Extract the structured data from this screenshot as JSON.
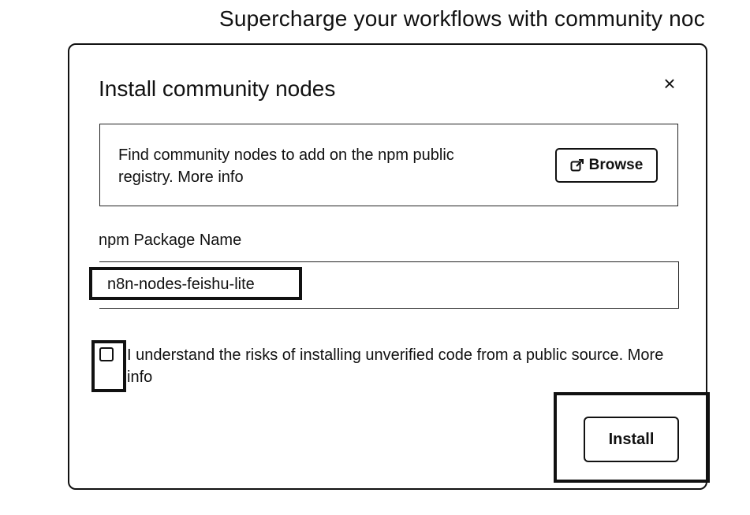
{
  "background": {
    "heading": "Supercharge your workflows with community noc"
  },
  "dialog": {
    "title": "Install community nodes",
    "close_icon": "×",
    "info": {
      "text": "Find community nodes to add on the npm public registry. More info",
      "browse_label": "Browse",
      "browse_icon": "external-link-icon"
    },
    "package_field": {
      "label": "npm Package Name",
      "value": "n8n-nodes-feishu-lite"
    },
    "consent": {
      "checked": false,
      "text": "I understand the risks of installing unverified code from a public source. More info"
    },
    "install_label": "Install"
  }
}
